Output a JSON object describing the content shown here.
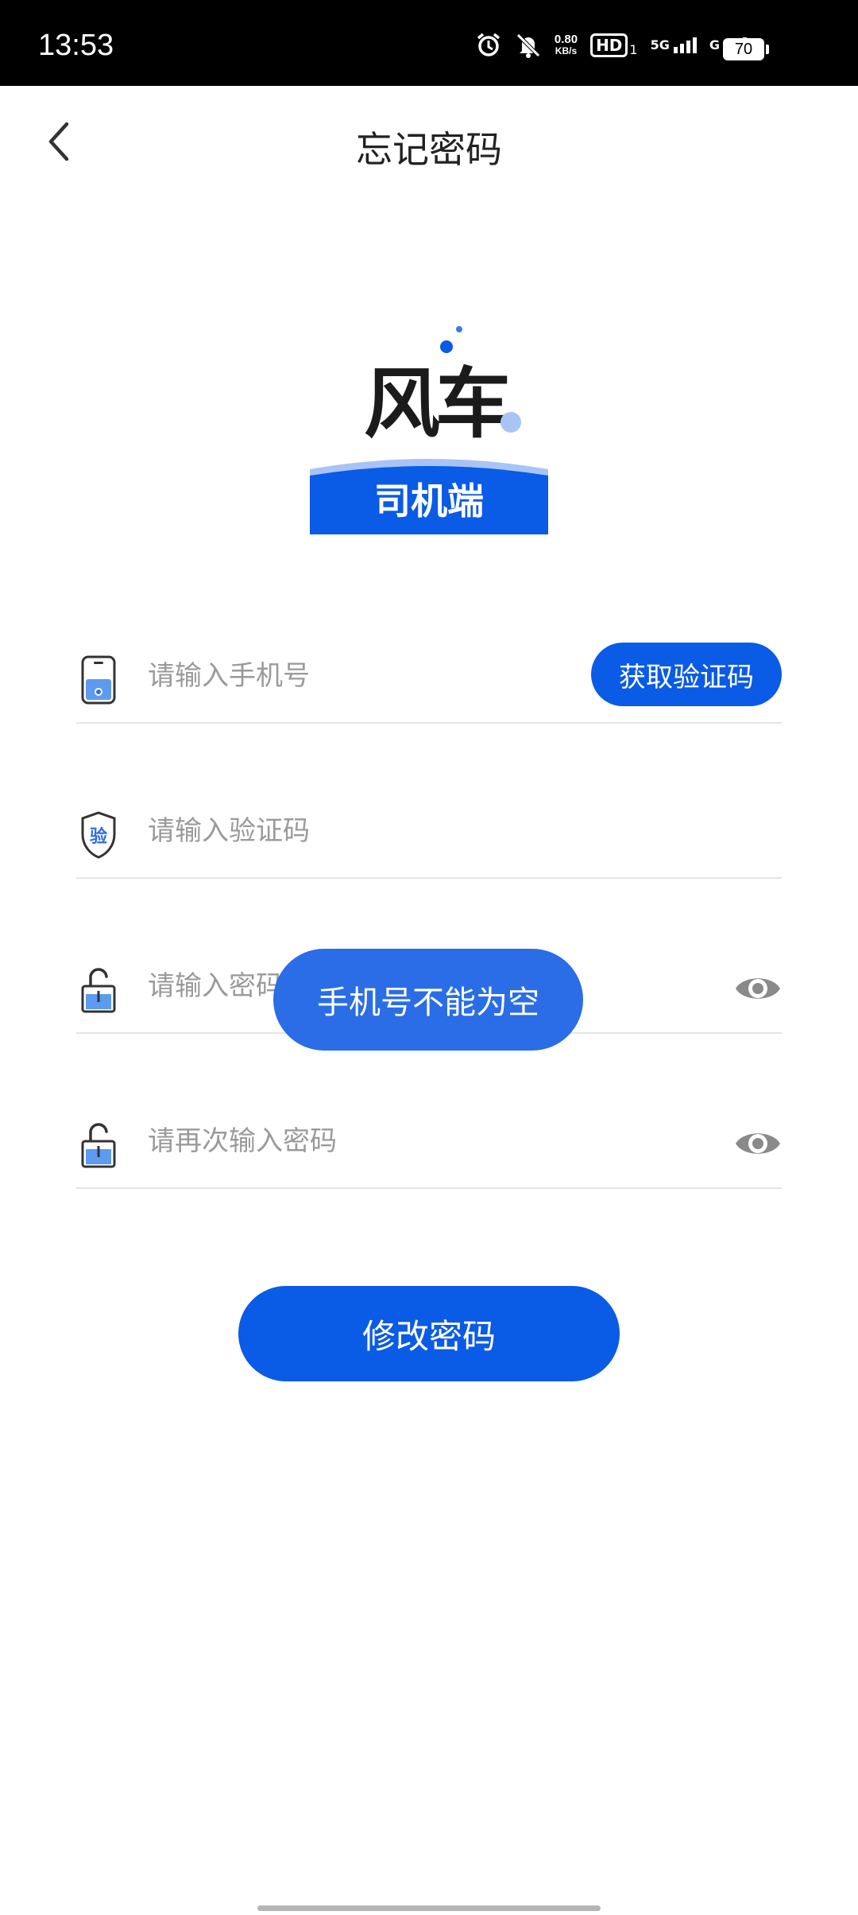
{
  "status_bar": {
    "time": "13:53",
    "net_speed_value": "0.80",
    "net_speed_unit": "KB/s",
    "hd_label": "HD",
    "hd_sub": "1",
    "signal1_label": "5G",
    "signal2_label": "G",
    "battery": "70",
    "icons": [
      "alarm-icon",
      "bell-off-icon",
      "hd-icon",
      "signal-5g-icon",
      "signal-g-icon",
      "battery-icon"
    ]
  },
  "header": {
    "title": "忘记密码",
    "back_icon": "chevron-left-icon"
  },
  "logo": {
    "brand_text": "风车",
    "band_label": "司机端",
    "colors": {
      "blue": "#0a5be6",
      "light_blue": "#a8c4f4"
    }
  },
  "form": {
    "phone": {
      "placeholder": "请输入手机号",
      "value": "",
      "icon": "phone-icon"
    },
    "get_code_label": "获取验证码",
    "code": {
      "placeholder": "请输入验证码",
      "value": "",
      "icon": "shield-code-icon",
      "icon_text": "验"
    },
    "password": {
      "placeholder": "请输入密码",
      "value": "",
      "icon": "lock-icon"
    },
    "password_confirm": {
      "placeholder": "请再次输入密码",
      "value": "",
      "icon": "lock-icon"
    },
    "eye_icon": "eye-icon"
  },
  "submit_label": "修改密码",
  "toast": "手机号不能为空",
  "colors": {
    "primary": "#0a5be6",
    "toast": "#2a6de6",
    "divider": "#e4e4e4",
    "placeholder": "#9a9a9a"
  }
}
